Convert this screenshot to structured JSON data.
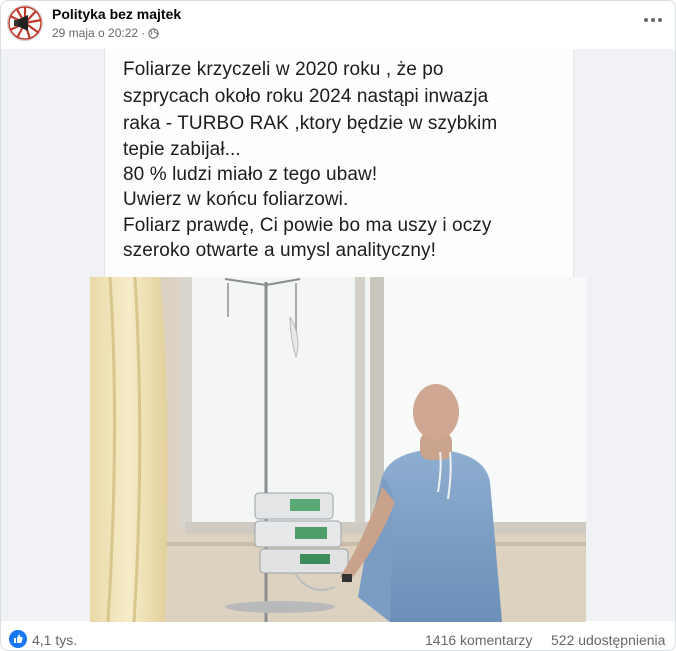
{
  "post": {
    "page_name": "Polityka bez majtek",
    "date": "29 maja o 20:22",
    "separator": "·",
    "privacy_icon": "globe-icon",
    "more_icon": "more-options-icon"
  },
  "text_card": {
    "lines": [
      "Foliarze krzyczeli w 2020 roku , że po",
      "szprycach około roku 2024 nastąpi inwazja",
      "raka - TURBO RAK ,ktory będzie w szybkim",
      "tepie zabijał...",
      "80 % ludzi miało z tego ubaw!",
      "Uwierz w końcu foliarzowi.",
      "Foliarz prawdę, Ci powie bo ma uszy i oczy",
      "szeroko otwarte a umysl analityczny!"
    ]
  },
  "photo": {
    "description_icon": "hospital-patient-photo"
  },
  "stats": {
    "reactions_icon": "like-icon",
    "reactions_count": "4,1 tys.",
    "comments": "1416 komentarzy",
    "shares": "522 udostępnienia"
  },
  "colors": {
    "like_blue": "#1877f2",
    "muted_text": "#65676b",
    "border": "#dadde1"
  }
}
